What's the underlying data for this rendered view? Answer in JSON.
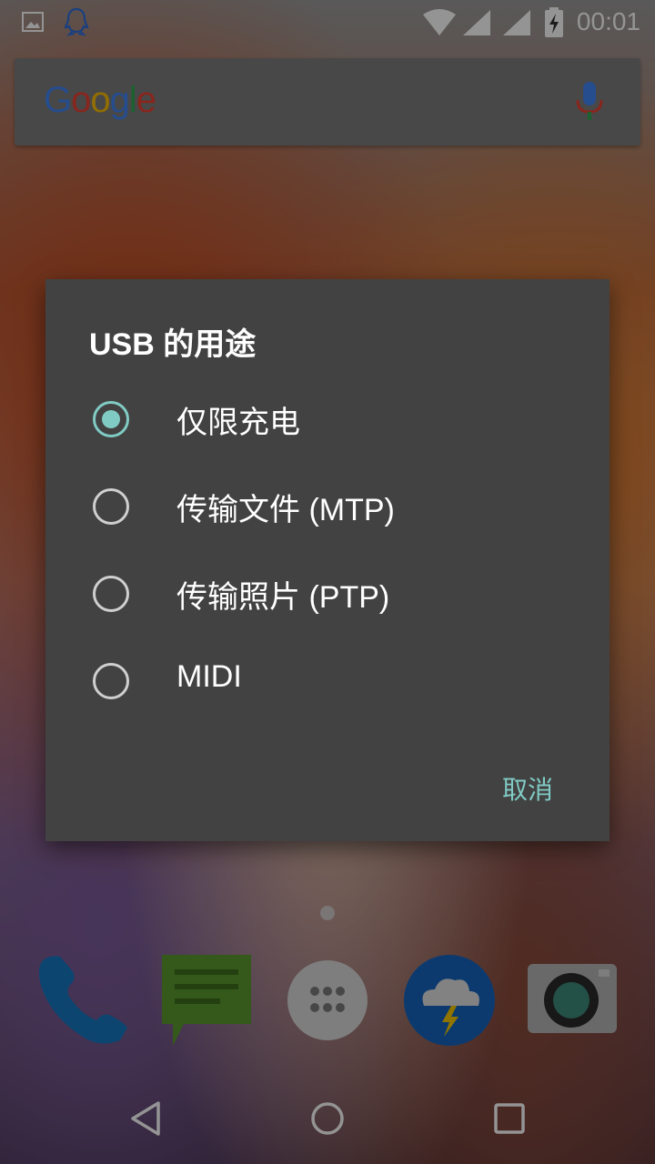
{
  "status_bar": {
    "time": "00:01",
    "icons": [
      "image-icon",
      "qq-icon",
      "wifi-icon",
      "signal-icon",
      "signal-icon",
      "battery-charging-icon"
    ]
  },
  "search_bar": {
    "logo_text": "Google",
    "colors": {
      "blue": "#4285f4",
      "red": "#ea4335",
      "yellow": "#fbbc05",
      "green": "#34a853"
    }
  },
  "dialog": {
    "title": "USB 的用途",
    "options": [
      {
        "label": "仅限充电",
        "selected": true
      },
      {
        "label": "传输文件 (MTP)",
        "selected": false
      },
      {
        "label": "传输照片 (PTP)",
        "selected": false
      },
      {
        "label": "MIDI",
        "selected": false
      }
    ],
    "cancel_label": "取消",
    "accent_color": "#80cbc4",
    "background_color": "#424242"
  },
  "dock": {
    "apps": [
      "phone-icon",
      "messages-icon",
      "app-drawer-icon",
      "weather-icon",
      "camera-icon"
    ]
  },
  "nav_bar": {
    "buttons": [
      "back-icon",
      "home-icon",
      "recents-icon"
    ]
  }
}
